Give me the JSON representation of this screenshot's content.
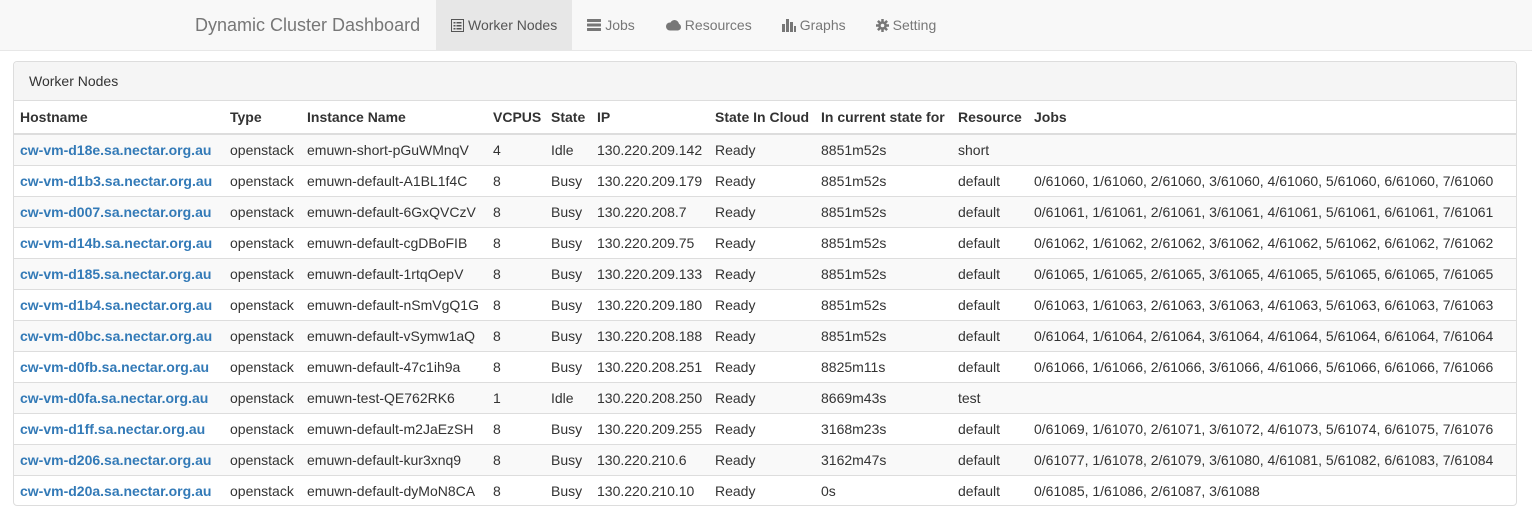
{
  "navbar": {
    "brand": "Dynamic Cluster Dashboard",
    "items": [
      {
        "label": "Worker Nodes",
        "icon": "list-icon",
        "active": true
      },
      {
        "label": "Jobs",
        "icon": "tasks-icon",
        "active": false
      },
      {
        "label": "Resources",
        "icon": "cloud-icon",
        "active": false
      },
      {
        "label": "Graphs",
        "icon": "bar-chart-icon",
        "active": false
      },
      {
        "label": "Setting",
        "icon": "gear-icon",
        "active": false
      }
    ]
  },
  "panel": {
    "title": "Worker Nodes",
    "columns": [
      "Hostname",
      "Type",
      "Instance Name",
      "VCPUS",
      "State",
      "IP",
      "State In Cloud",
      "In current state for",
      "Resource",
      "Jobs"
    ],
    "rows": [
      [
        "cw-vm-d18e.sa.nectar.org.au",
        "openstack",
        "emuwn-short-pGuWMnqV",
        "4",
        "Idle",
        "130.220.209.142",
        "Ready",
        "8851m52s",
        "short",
        ""
      ],
      [
        "cw-vm-d1b3.sa.nectar.org.au",
        "openstack",
        "emuwn-default-A1BL1f4C",
        "8",
        "Busy",
        "130.220.209.179",
        "Ready",
        "8851m52s",
        "default",
        "0/61060, 1/61060, 2/61060, 3/61060, 4/61060, 5/61060, 6/61060, 7/61060"
      ],
      [
        "cw-vm-d007.sa.nectar.org.au",
        "openstack",
        "emuwn-default-6GxQVCzV",
        "8",
        "Busy",
        "130.220.208.7",
        "Ready",
        "8851m52s",
        "default",
        "0/61061, 1/61061, 2/61061, 3/61061, 4/61061, 5/61061, 6/61061, 7/61061"
      ],
      [
        "cw-vm-d14b.sa.nectar.org.au",
        "openstack",
        "emuwn-default-cgDBoFIB",
        "8",
        "Busy",
        "130.220.209.75",
        "Ready",
        "8851m52s",
        "default",
        "0/61062, 1/61062, 2/61062, 3/61062, 4/61062, 5/61062, 6/61062, 7/61062"
      ],
      [
        "cw-vm-d185.sa.nectar.org.au",
        "openstack",
        "emuwn-default-1rtqOepV",
        "8",
        "Busy",
        "130.220.209.133",
        "Ready",
        "8851m52s",
        "default",
        "0/61065, 1/61065, 2/61065, 3/61065, 4/61065, 5/61065, 6/61065, 7/61065"
      ],
      [
        "cw-vm-d1b4.sa.nectar.org.au",
        "openstack",
        "emuwn-default-nSmVgQ1G",
        "8",
        "Busy",
        "130.220.209.180",
        "Ready",
        "8851m52s",
        "default",
        "0/61063, 1/61063, 2/61063, 3/61063, 4/61063, 5/61063, 6/61063, 7/61063"
      ],
      [
        "cw-vm-d0bc.sa.nectar.org.au",
        "openstack",
        "emuwn-default-vSymw1aQ",
        "8",
        "Busy",
        "130.220.208.188",
        "Ready",
        "8851m52s",
        "default",
        "0/61064, 1/61064, 2/61064, 3/61064, 4/61064, 5/61064, 6/61064, 7/61064"
      ],
      [
        "cw-vm-d0fb.sa.nectar.org.au",
        "openstack",
        "emuwn-default-47c1ih9a",
        "8",
        "Busy",
        "130.220.208.251",
        "Ready",
        "8825m11s",
        "default",
        "0/61066, 1/61066, 2/61066, 3/61066, 4/61066, 5/61066, 6/61066, 7/61066"
      ],
      [
        "cw-vm-d0fa.sa.nectar.org.au",
        "openstack",
        "emuwn-test-QE762RK6",
        "1",
        "Idle",
        "130.220.208.250",
        "Ready",
        "8669m43s",
        "test",
        ""
      ],
      [
        "cw-vm-d1ff.sa.nectar.org.au",
        "openstack",
        "emuwn-default-m2JaEzSH",
        "8",
        "Busy",
        "130.220.209.255",
        "Ready",
        "3168m23s",
        "default",
        "0/61069, 1/61070, 2/61071, 3/61072, 4/61073, 5/61074, 6/61075, 7/61076"
      ],
      [
        "cw-vm-d206.sa.nectar.org.au",
        "openstack",
        "emuwn-default-kur3xnq9",
        "8",
        "Busy",
        "130.220.210.6",
        "Ready",
        "3162m47s",
        "default",
        "0/61077, 1/61078, 2/61079, 3/61080, 4/61081, 5/61082, 6/61083, 7/61084"
      ],
      [
        "cw-vm-d20a.sa.nectar.org.au",
        "openstack",
        "emuwn-default-dyMoN8CA",
        "8",
        "Busy",
        "130.220.210.10",
        "Ready",
        "0s",
        "default",
        "0/61085, 1/61086, 2/61087, 3/61088"
      ]
    ]
  },
  "colors": {
    "link": "#337ab7",
    "navbar_bg": "#f8f8f8",
    "nav_active_bg": "#e7e7e7",
    "stripe": "#f9f9f9",
    "border": "#dddddd"
  }
}
